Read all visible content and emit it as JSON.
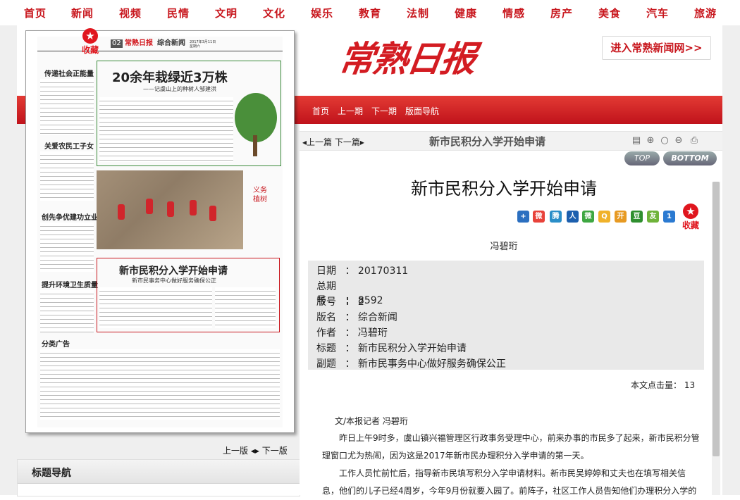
{
  "top_nav": [
    "首页",
    "新闻",
    "视频",
    "民情",
    "文明",
    "文化",
    "娱乐",
    "教育",
    "法制",
    "健康",
    "情感",
    "房产",
    "美食",
    "汽车",
    "旅游"
  ],
  "header": {
    "logo": "常熟日报",
    "enter_button": "进入常熟新闻网>>",
    "subnav": [
      "首页",
      "上一期",
      "下一期",
      "版面导航"
    ]
  },
  "paper": {
    "collect": "收藏",
    "page_no": "02",
    "page_masthead": "常熟日报",
    "page_section": "综合新闻",
    "page_date": "2017年3月11日 星期六",
    "left_headlines": [
      "传递社会正能量",
      "关爱农民工子女",
      "创先争优建功立业",
      "提升环境卫生质量"
    ],
    "main_headline": "20余年栽绿近3万株",
    "main_subhead": "——记虞山上的种树人邹建洪",
    "photo_caption": "义务植树",
    "focus_headline": "新市民积分入学开始申请",
    "focus_subhead": "新市民事务中心做好服务确保公正",
    "classified": "分类广告"
  },
  "pager": {
    "prev": "上一版",
    "next": "下一版"
  },
  "title_nav": {
    "label": "标题导航"
  },
  "article": {
    "toolbar_prev": "上一篇",
    "toolbar_next": "下一篇",
    "toolbar_title": "新市民积分入学开始申请",
    "top_button": "TOP",
    "bottom_button": "BOTTOM",
    "title": "新市民积分入学开始申请",
    "collect": "收藏",
    "author": "冯碧珩",
    "meta": [
      {
        "key": "日期",
        "value": "20170311"
      },
      {
        "key": "总期号",
        "value": "8592"
      },
      {
        "key": "版号",
        "value": "2"
      },
      {
        "key": "版名",
        "value": "综合新闻"
      },
      {
        "key": "作者",
        "value": "冯碧珩"
      },
      {
        "key": "标题",
        "value": "新市民积分入学开始申请"
      },
      {
        "key": "副题",
        "value": "新市民事务中心做好服务确保公正"
      }
    ],
    "clicks_label": "本文点击量：",
    "clicks_value": "13",
    "byline": "文/本报记者 冯碧珩",
    "paragraphs": [
      "昨日上午9时多，虞山镇兴福管理区行政事务受理中心，前来办事的市民多了起来，新市民积分管理窗口尤为热闹，因为这是2017年新市民办理积分入学申请的第一天。",
      "工作人员忙前忙后，指导新市民填写积分入学申请材料。新市民吴婷婷和丈夫也在填写相关信息，他们的儿子已经4周岁，今年9月份就要入园了。前阵子，社区工作人员告知他们办理积分入学的"
    ]
  },
  "colors": {
    "brand_red": "#c8161d",
    "bar_red": "#d9252b"
  },
  "share_icons": [
    "plus-icon",
    "weibo-icon",
    "tencent-weibo-icon",
    "renren-icon",
    "wechat-icon",
    "qzone-icon",
    "kaixin-icon",
    "douban-icon",
    "friends-icon",
    "baidu-icon"
  ]
}
